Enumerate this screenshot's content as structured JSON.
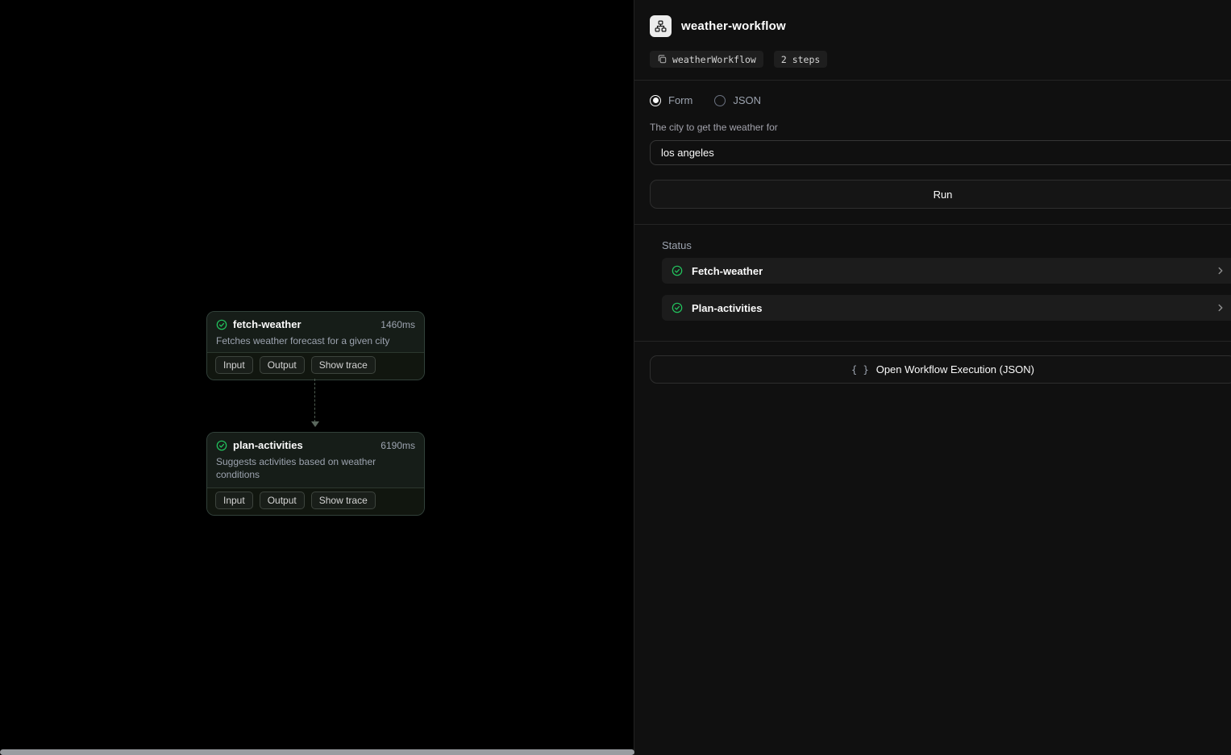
{
  "canvas": {
    "nodes": [
      {
        "title": "fetch-weather",
        "duration": "1460ms",
        "description": "Fetches weather forecast for a given city",
        "status": "success",
        "actions": {
          "input": "Input",
          "output": "Output",
          "trace": "Show trace"
        }
      },
      {
        "title": "plan-activities",
        "duration": "6190ms",
        "description": "Suggests activities based on weather conditions",
        "status": "success",
        "actions": {
          "input": "Input",
          "output": "Output",
          "trace": "Show trace"
        }
      }
    ]
  },
  "panel": {
    "title": "weather-workflow",
    "badges": {
      "workflow_id": "weatherWorkflow",
      "steps": "2 steps"
    },
    "view_toggle": {
      "form": "Form",
      "json": "JSON",
      "selected": "Form"
    },
    "form": {
      "city_label": "The city to get the weather for",
      "city_value": "los angeles",
      "run_label": "Run"
    },
    "status": {
      "heading": "Status",
      "items": [
        {
          "label": "Fetch-weather",
          "state": "success"
        },
        {
          "label": "Plan-activities",
          "state": "success"
        }
      ]
    },
    "execution": {
      "icon": "{ }",
      "label": "Open Workflow Execution (JSON)"
    },
    "colors": {
      "success_green": "#22c55e",
      "panel_bg": "#101010",
      "canvas_bg": "#000000"
    }
  }
}
